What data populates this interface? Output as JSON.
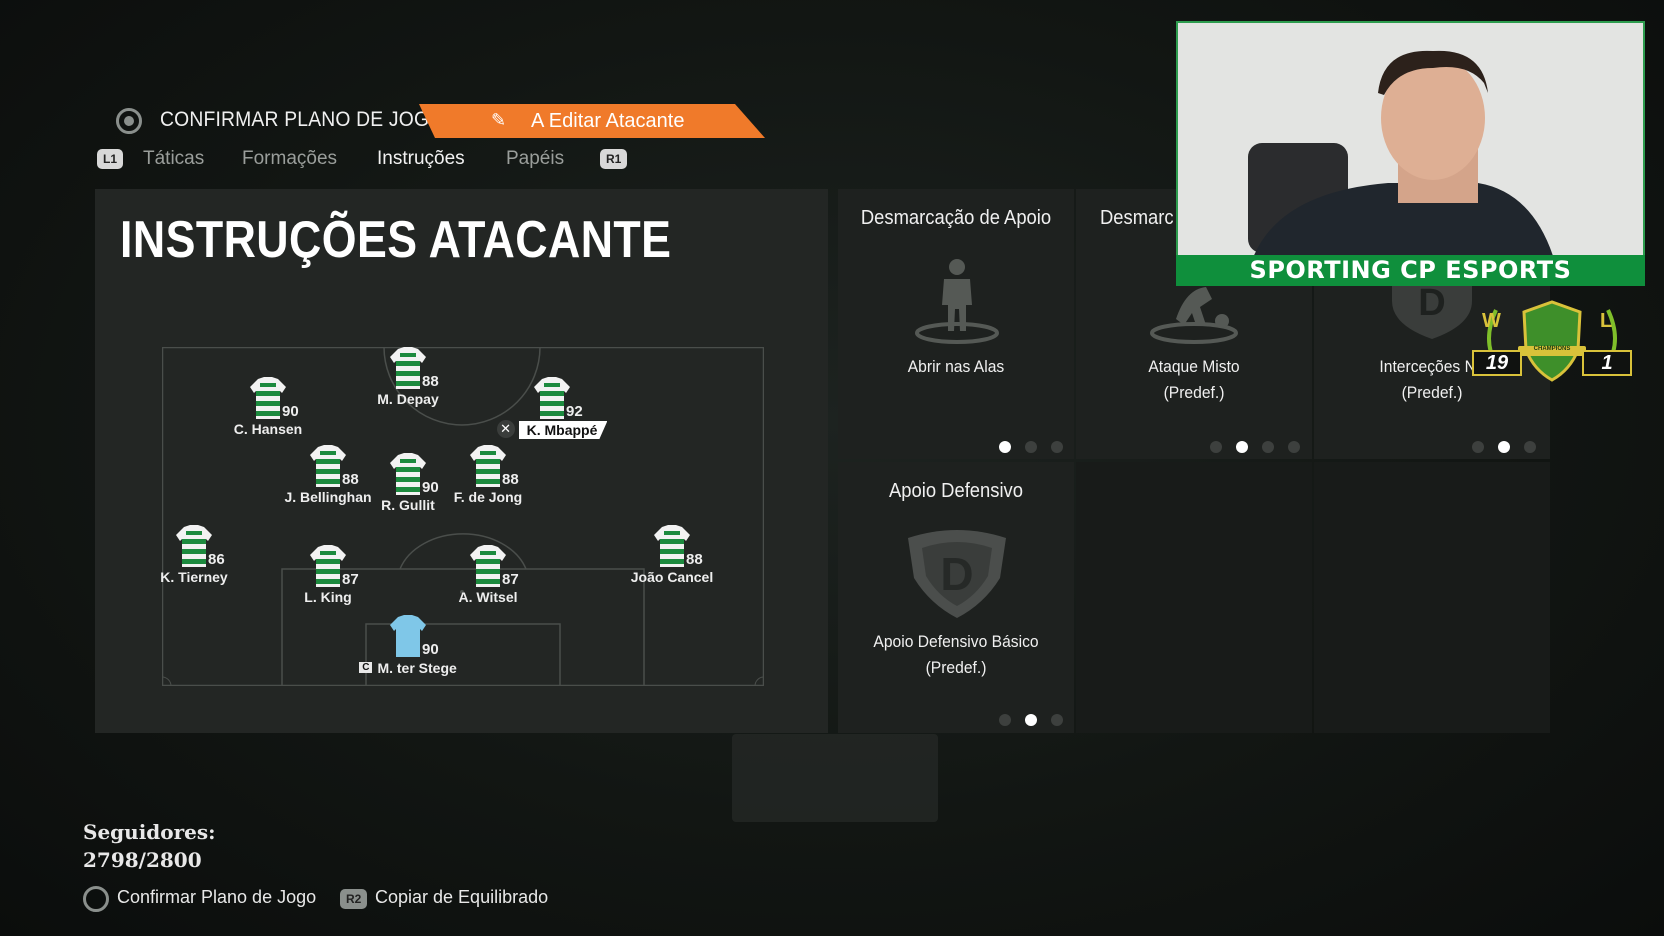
{
  "header": {
    "confirm_title": "CONFIRMAR PLANO DE JOGO",
    "editing_label": "A Editar Atacante",
    "icons": {
      "confirm": "circle-button-icon",
      "edit": "pencil-icon"
    }
  },
  "tabs": {
    "left_button": "L1",
    "right_button": "R1",
    "items": [
      {
        "label": "Táticas",
        "active": false
      },
      {
        "label": "Formações",
        "active": false
      },
      {
        "label": "Instruções",
        "active": true
      },
      {
        "label": "Papéis",
        "active": false
      }
    ]
  },
  "panel": {
    "title": "INSTRUÇÕES ATACANTE"
  },
  "players": [
    {
      "name": "M. Depay",
      "rating": "88"
    },
    {
      "name": "C. Hansen",
      "rating": "90"
    },
    {
      "name": "K. Mbappé",
      "rating": "92",
      "selected": true
    },
    {
      "name": "J. Bellinghan",
      "rating": "88"
    },
    {
      "name": "R. Gullit",
      "rating": "90"
    },
    {
      "name": "F. de Jong",
      "rating": "88"
    },
    {
      "name": "K. Tierney",
      "rating": "86"
    },
    {
      "name": "L. King",
      "rating": "87"
    },
    {
      "name": "A. Witsel",
      "rating": "87"
    },
    {
      "name": "João Cancel",
      "rating": "88"
    },
    {
      "name": "M. ter Stege",
      "rating": "90",
      "captain": "C",
      "goalkeeper": true
    }
  ],
  "cards": [
    {
      "title": "Desmarcação de Apoio",
      "option": "Abrir nas Alas",
      "option2": "",
      "dots": 3,
      "active_dot": 0,
      "icon": "player-standing-icon"
    },
    {
      "title": "Desmarc",
      "option": "Ataque Misto",
      "option2": "(Predef.)",
      "dots": 4,
      "active_dot": 1,
      "icon": "player-dribbling-icon"
    },
    {
      "title": "",
      "option": "Interceções No",
      "option2": "(Predef.)",
      "dots": 3,
      "active_dot": 1,
      "icon": "shield-d-icon"
    },
    {
      "title": "Apoio Defensivo",
      "option": "Apoio Defensivo Básico",
      "option2": "(Predef.)",
      "dots": 3,
      "active_dot": 1,
      "icon": "shield-d-icon"
    }
  ],
  "webcam": {
    "banner": "SPORTING CP ESPORTS"
  },
  "record": {
    "wins_label": "W",
    "wins": "19",
    "losses_label": "L",
    "losses": "1",
    "badge_text": "CHAMPIONS"
  },
  "footer": {
    "followers_label": "Seguidores:",
    "followers_value": "2798/2800",
    "actions": [
      {
        "button": "circle",
        "label": "Confirmar Plano de Jogo"
      },
      {
        "button": "R2",
        "label": "Copiar de Equilibrado"
      }
    ]
  },
  "colors": {
    "accent_orange": "#f07a2a",
    "sporting_green": "#0f8f3c",
    "panel": "#232624"
  }
}
